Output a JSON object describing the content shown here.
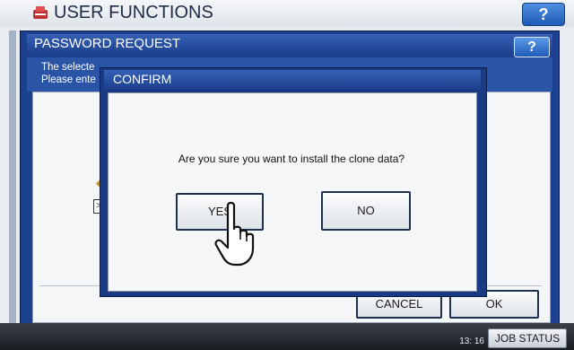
{
  "app": {
    "title": "USER FUNCTIONS",
    "help_label": "?"
  },
  "password_dialog": {
    "title": "PASSWORD REQUEST",
    "help_label": "?",
    "message_line1": "The selecte",
    "message_line2": "Please ente",
    "partial_field_text": ">",
    "buttons": {
      "cancel": "CANCEL",
      "ok": "OK"
    }
  },
  "confirm_dialog": {
    "title": "CONFIRM",
    "message": "Are you sure you want to install the clone data?",
    "yes_label": "YES",
    "no_label": "NO"
  },
  "status_bar": {
    "date_partial": "",
    "time": "13: 16",
    "job_status_label": "JOB STATUS"
  },
  "colors": {
    "dialog_blue": "#1d3f8f",
    "header_blue": "#3560b4",
    "help_blue": "#1f5bb6",
    "bottom_bar": "#1a1d22"
  }
}
